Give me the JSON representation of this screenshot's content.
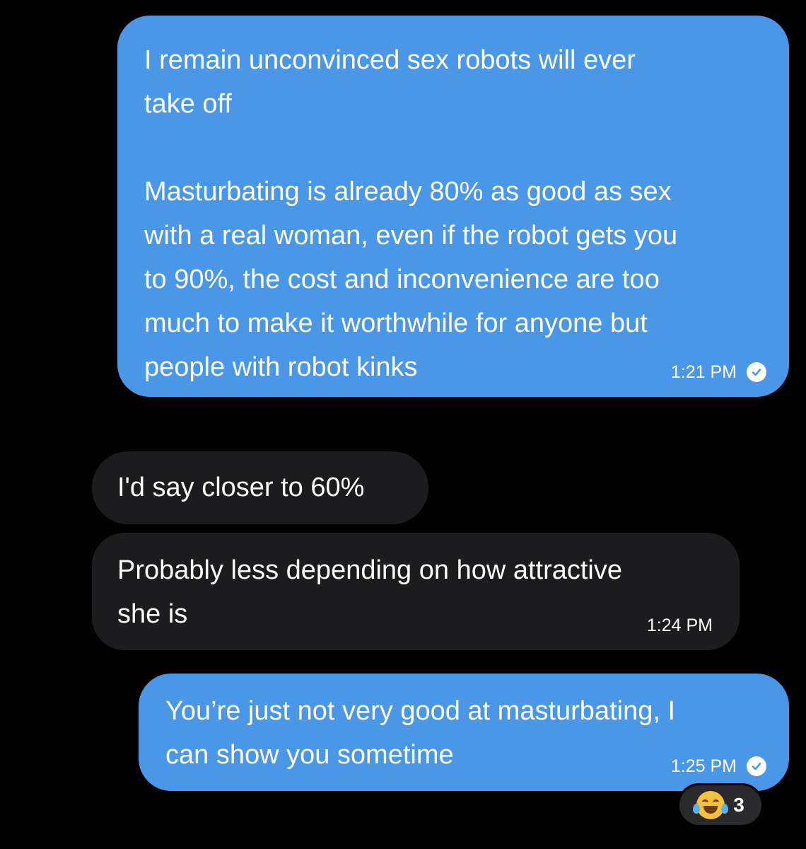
{
  "messages": [
    {
      "direction": "sent",
      "text": "I remain unconvinced sex robots will ever\ntake off\n\nMasturbating is already 80% as good as sex\nwith a real woman, even if the robot gets you\nto 90%, the cost and inconvenience are too\nmuch to make it worthwhile for anyone but\npeople with robot kinks",
      "time": "1:21 PM",
      "read_icon": "check-circle-icon"
    },
    {
      "direction": "received",
      "text": "I'd say closer to 60%"
    },
    {
      "direction": "received",
      "text": "Probably less depending on how attractive\nshe is",
      "time": "1:24 PM"
    },
    {
      "direction": "sent",
      "text": "You’re just not very good at masturbating, I\ncan show you sometime",
      "time": "1:25 PM",
      "read_icon": "check-circle-icon",
      "reaction": {
        "emoji_icon": "tears-of-joy-emoji-icon",
        "count": "3"
      }
    }
  ],
  "colors": {
    "background": "#000000",
    "sent_bubble": "#4a96e7",
    "received_bubble": "#1c1c1e",
    "reaction_pill": "#2a2a2c"
  }
}
